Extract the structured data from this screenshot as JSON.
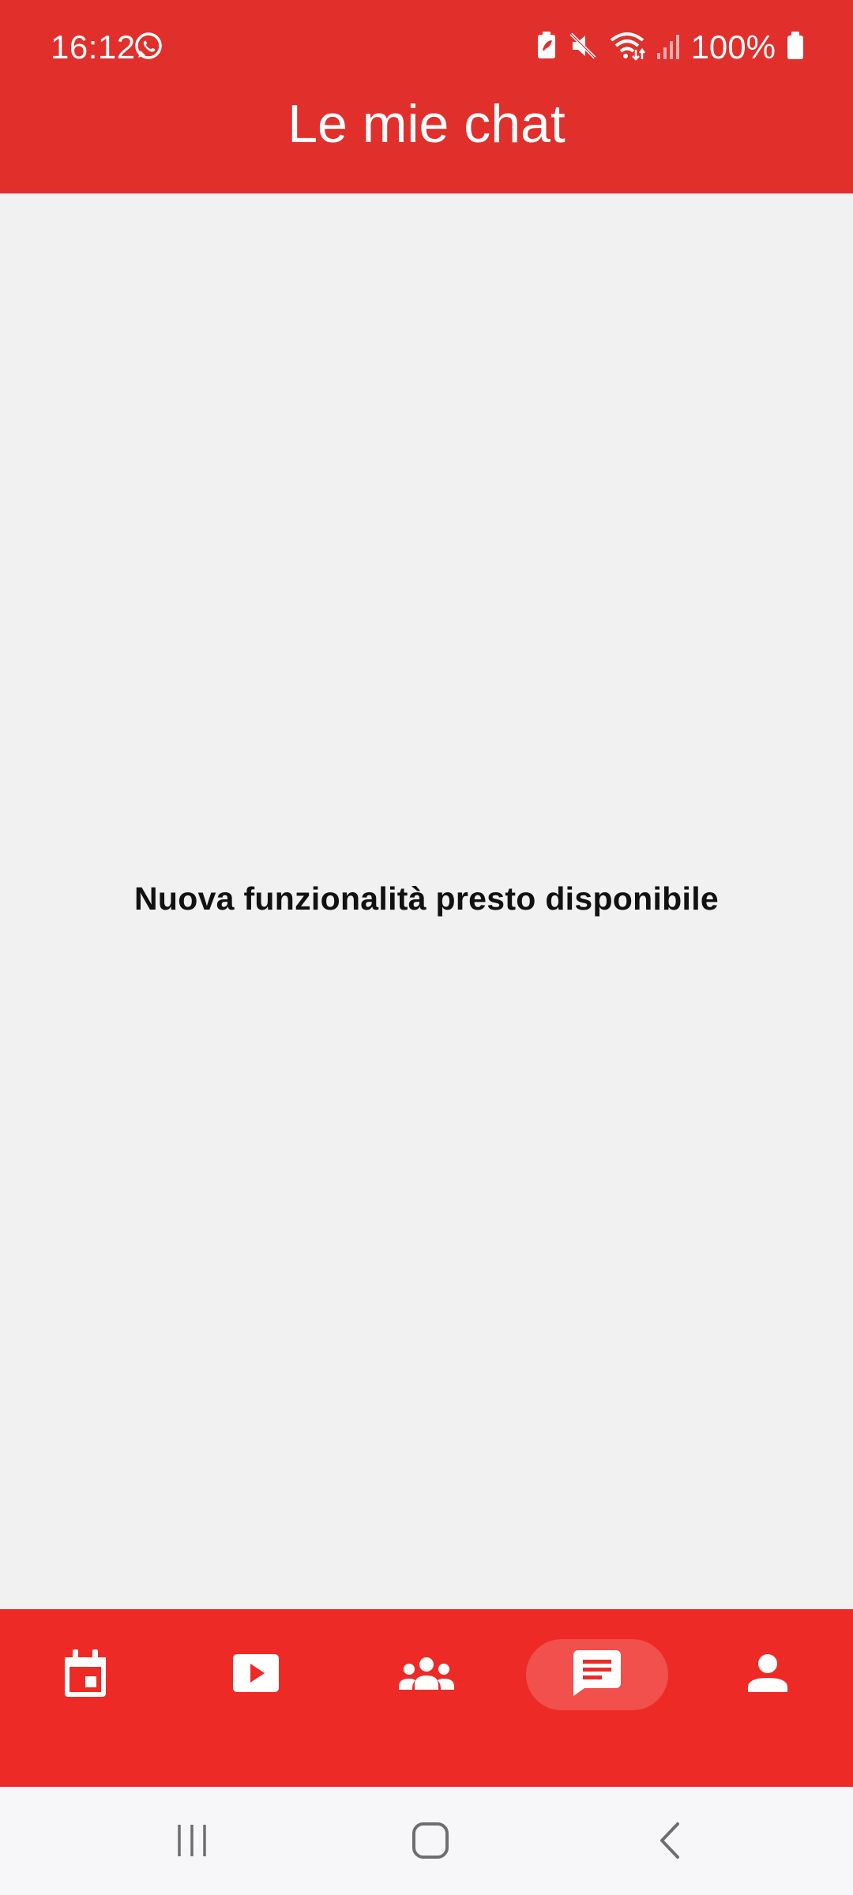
{
  "status_bar": {
    "time": "16:12",
    "battery": "100%",
    "icons": [
      "whatsapp-icon",
      "battery-saver-icon",
      "mute-icon",
      "wifi-icon",
      "signal-icon",
      "battery-icon"
    ]
  },
  "header": {
    "title": "Le mie chat"
  },
  "main": {
    "message": "Nuova funzionalità presto disponibile"
  },
  "bottom_nav": {
    "items": [
      {
        "icon": "calendar-icon",
        "active": false
      },
      {
        "icon": "video-play-icon",
        "active": false
      },
      {
        "icon": "groups-icon",
        "active": false
      },
      {
        "icon": "chat-icon",
        "active": true
      },
      {
        "icon": "person-icon",
        "active": false
      }
    ]
  },
  "system_nav": {
    "icons": [
      "recent-apps-icon",
      "home-icon",
      "back-icon"
    ]
  },
  "colors": {
    "header_red": "#e12f2c",
    "nav_red": "#ee2a26",
    "background": "#f1f1f1"
  }
}
